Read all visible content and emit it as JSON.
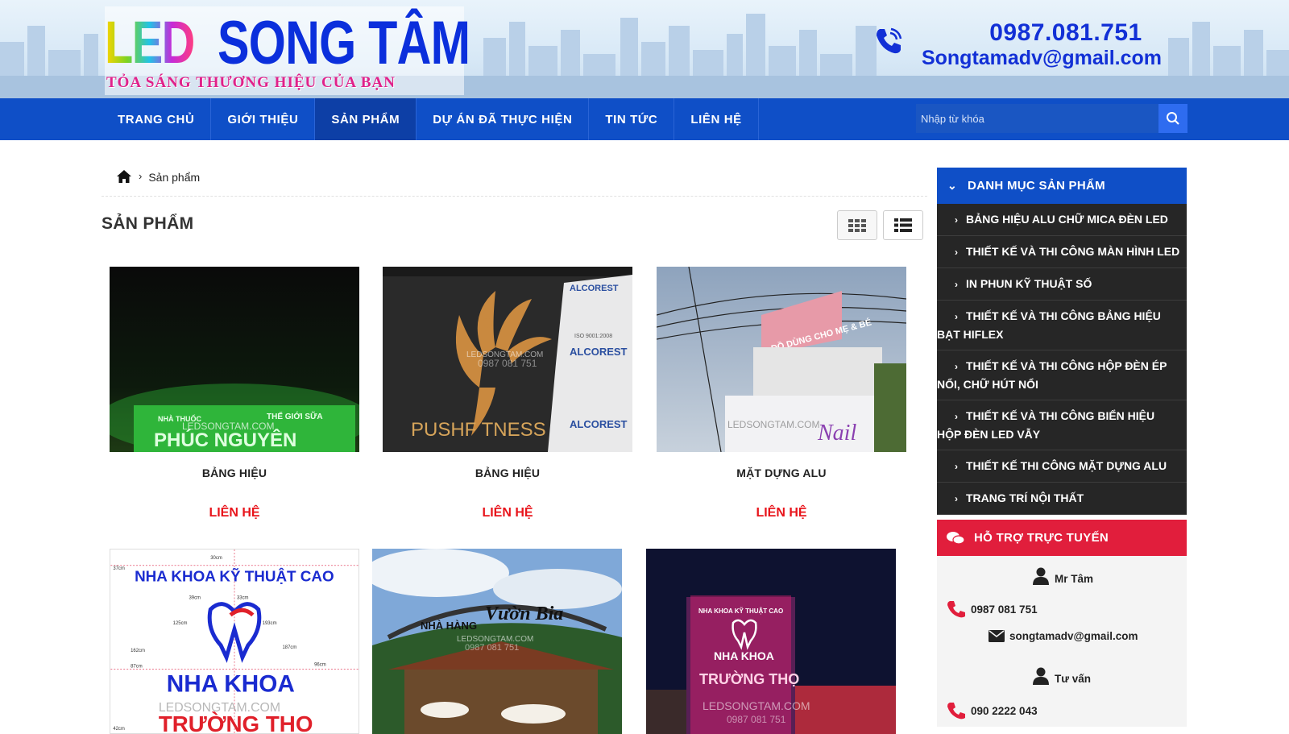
{
  "header": {
    "logo_led": "LED",
    "logo_name": "SONG TÂM",
    "logo_slogan": "TỎA SÁNG THƯƠNG HIỆU CỦA BẠN",
    "phone": "0987.081.751",
    "email": "Songtamadv@gmail.com"
  },
  "nav": {
    "items": [
      "TRANG CHỦ",
      "GIỚI THIỆU",
      "SẢN PHẨM",
      "DỰ ÁN ĐÃ THỰC HIỆN",
      "TIN TỨC",
      "LIÊN HỆ"
    ],
    "active_index": 2,
    "search_placeholder": "Nhập từ khóa"
  },
  "breadcrumb": {
    "current": "Sản phẩm"
  },
  "main": {
    "title": "SẢN PHẨM",
    "products": [
      {
        "name": "BẢNG HIỆU",
        "price": "LIÊN HỆ",
        "photo_text": [
          "NHÀ THUỐC",
          "THẾ GIỚI SỮA",
          "PHÚC NGUYÊN",
          "LEDSONGTAM.COM"
        ]
      },
      {
        "name": "BẢNG HIỆU",
        "price": "LIÊN HỆ",
        "photo_text": [
          "PUSHF TNESS",
          "ALCOREST",
          "ISO 9001:2008",
          "LEDSONGTAM.COM",
          "0987 081 751"
        ]
      },
      {
        "name": "MẶT DỰNG ALU",
        "price": "LIÊN HỆ",
        "photo_text": [
          "ĐỒ DÙNG CHO MẸ & BÉ",
          "Nail",
          "LEDSONGTAM.COM"
        ]
      },
      {
        "name": "",
        "price": "",
        "photo_text": [
          "NHA KHOA KỸ THUẬT CAO",
          "NHA KHOA",
          "TRƯỜNG THỌ",
          "LEDSONGTAM.COM",
          "37cm",
          "30cm",
          "39cm",
          "33cm",
          "125cm",
          "193cm",
          "162cm",
          "187cm",
          "87cm",
          "96cm",
          "42cm"
        ]
      },
      {
        "name": "",
        "price": "",
        "photo_text": [
          "NHÀ HÀNG",
          "Vườn Bia",
          "LEDSONGTAM.COM",
          "0987 081 751"
        ]
      },
      {
        "name": "",
        "price": "",
        "photo_text": [
          "NHA KHOA KỸ THUẬT CAO",
          "NHA KHOA",
          "TRƯỜNG THỌ",
          "LEDSONGTAM.COM",
          "0987 081 751"
        ]
      }
    ]
  },
  "sidebar": {
    "categories_title": "DANH MỤC SẢN PHẨM",
    "categories": [
      "BẢNG HIỆU ALU CHỮ MICA ĐÈN LED",
      "THIẾT KẾ VÀ THI CÔNG MÀN HÌNH LED",
      "IN PHUN KỸ THUẬT SỐ",
      "THIẾT KẾ VÀ THI CÔNG BẢNG HIỆU BẠT HIFLEX",
      "THIẾT KẾ VÀ THI CÔNG HỘP ĐÈN ÉP NỔI, CHỮ HÚT NỔI",
      "THIẾT KẾ VÀ THI CÔNG BIỂN HIỆU HỘP ĐÈN LED VẪY",
      "THIẾT KẾ THI CÔNG MẶT DỰNG ALU",
      "TRANG TRÍ NỘI THẤT"
    ],
    "support_title": "HỖ TRỢ TRỰC TUYẾN",
    "support": [
      {
        "name": "Mr Tâm",
        "phone": "0987 081 751",
        "email": "songtamadv@gmail.com"
      },
      {
        "name": "Tư vấn",
        "phone": "090 2222 043"
      }
    ]
  },
  "colors": {
    "nav_blue": "#0f4fc7",
    "price_red": "#e8141b",
    "support_red": "#e11e3c",
    "cat_dark": "#262626"
  }
}
